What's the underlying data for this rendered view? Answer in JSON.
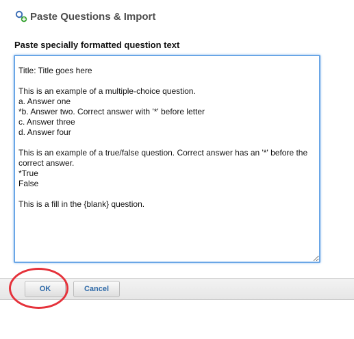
{
  "header": {
    "icon": "question-add-icon",
    "title": "Paste Questions & Import"
  },
  "form": {
    "label": "Paste specially formatted question text",
    "textarea_value": "Title: Title goes here\n\nThis is an example of a multiple-choice question.\na. Answer one\n*b. Answer two. Correct answer with '*' before letter\nc. Answer three\nd. Answer four\n\nThis is an example of a true/false question. Correct answer has an '*' before the correct answer.\n*True\nFalse\n\nThis is a fill in the {blank} question."
  },
  "buttons": {
    "ok_label": "OK",
    "cancel_label": "Cancel"
  },
  "colors": {
    "accent": "#2f6aa8",
    "focus_border": "#6aa6e6",
    "highlight_ring": "#e5323b"
  }
}
